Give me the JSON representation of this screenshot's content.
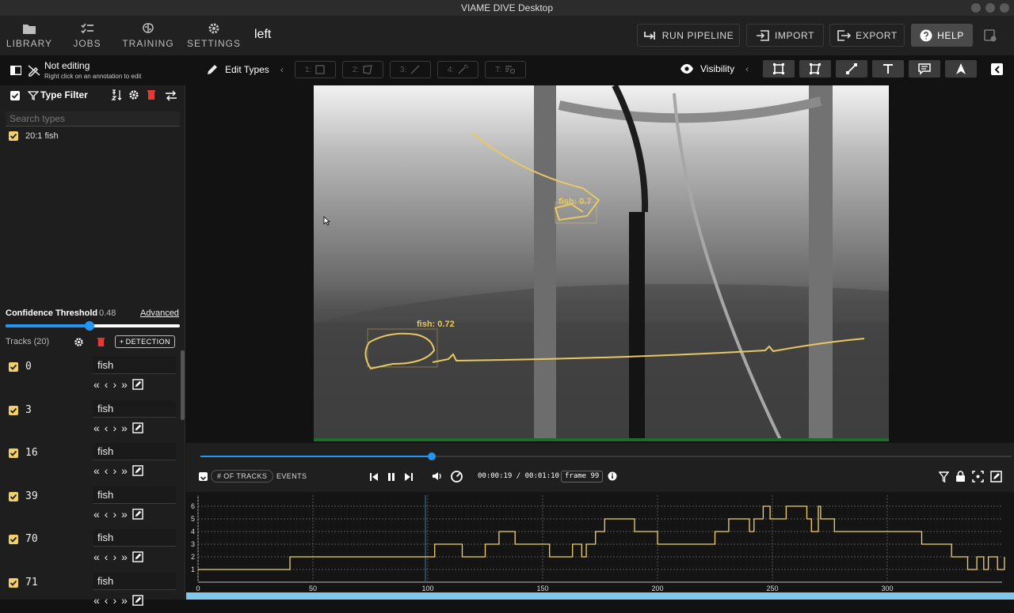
{
  "window_title": "VIAME DIVE Desktop",
  "nav": [
    {
      "label": "LIBRARY",
      "icon": "folder-icon"
    },
    {
      "label": "JOBS",
      "icon": "checklist-icon"
    },
    {
      "label": "TRAINING",
      "icon": "brain-icon"
    },
    {
      "label": "SETTINGS",
      "icon": "gear-icon"
    }
  ],
  "dataset_name": "left",
  "actions": {
    "run_pipeline": "RUN PIPELINE",
    "import": "IMPORT",
    "export": "EXPORT",
    "help": "HELP"
  },
  "edit_state": {
    "title": "Not editing",
    "hint": "Right click on an annotation to edit"
  },
  "edit_types_label": "Edit Types",
  "edit_type_boxes": [
    "1:",
    "2:",
    "3:",
    "4:",
    "T:"
  ],
  "visibility_label": "Visibility",
  "type_filter": {
    "title": "Type Filter",
    "search_placeholder": "Search types",
    "types": [
      {
        "label": "20:1 fish"
      }
    ]
  },
  "confidence": {
    "label": "Confidence Threshold",
    "value": "0.48",
    "fraction": 0.48,
    "advanced": "Advanced"
  },
  "tracks_header": {
    "label": "Tracks (20)",
    "detection_button": "DETECTION"
  },
  "tracks": [
    {
      "id": "0",
      "type": "fish"
    },
    {
      "id": "3",
      "type": "fish"
    },
    {
      "id": "16",
      "type": "fish"
    },
    {
      "id": "39",
      "type": "fish"
    },
    {
      "id": "70",
      "type": "fish"
    },
    {
      "id": "71",
      "type": "fish"
    }
  ],
  "detections": [
    {
      "label": "fish: 0.7"
    },
    {
      "label": "fish: 0.72"
    }
  ],
  "playback": {
    "time": "00:00:19 / 00:01:10",
    "frame": "frame 99",
    "progress": 0.285,
    "tabs": [
      "# OF TRACKS",
      "EVENTS"
    ]
  },
  "accent": "#f1d06b",
  "chart_data": {
    "type": "line",
    "x_ticks": [
      0,
      50,
      100,
      150,
      200,
      250,
      300
    ],
    "y_ticks": [
      1,
      2,
      3,
      4,
      5,
      6
    ],
    "xlim": [
      0,
      350
    ],
    "ylim": [
      0,
      6.5
    ],
    "cursor_x": 99,
    "series": [
      {
        "x": [
          0,
          40,
          40,
          103,
          103,
          115,
          115,
          125,
          125,
          131,
          131,
          138,
          138,
          153,
          153,
          163,
          163,
          167,
          167,
          169,
          169,
          173,
          173,
          177,
          177,
          190,
          190,
          200,
          200,
          225,
          225,
          231,
          231,
          240,
          240,
          242,
          242,
          246,
          246,
          249,
          249,
          256,
          256,
          265,
          265,
          267,
          267,
          270,
          270,
          271,
          271,
          277,
          277,
          315,
          315,
          328,
          328,
          335,
          335,
          339,
          339,
          342,
          342,
          344,
          344,
          348,
          348,
          351,
          351
        ],
        "y": [
          1,
          1,
          2,
          2,
          3,
          3,
          2,
          2,
          3,
          3,
          4,
          4,
          3,
          3,
          2,
          2,
          3,
          3,
          2,
          2,
          3,
          3,
          4,
          4,
          5,
          5,
          4,
          4,
          3,
          3,
          4,
          4,
          5,
          5,
          4,
          4,
          5,
          5,
          6,
          6,
          5,
          5,
          6,
          6,
          5,
          5,
          4,
          4,
          6,
          6,
          5,
          5,
          4,
          4,
          3,
          3,
          2,
          2,
          1,
          1,
          2,
          2,
          1,
          1,
          2,
          2,
          1,
          1,
          2
        ]
      }
    ]
  }
}
